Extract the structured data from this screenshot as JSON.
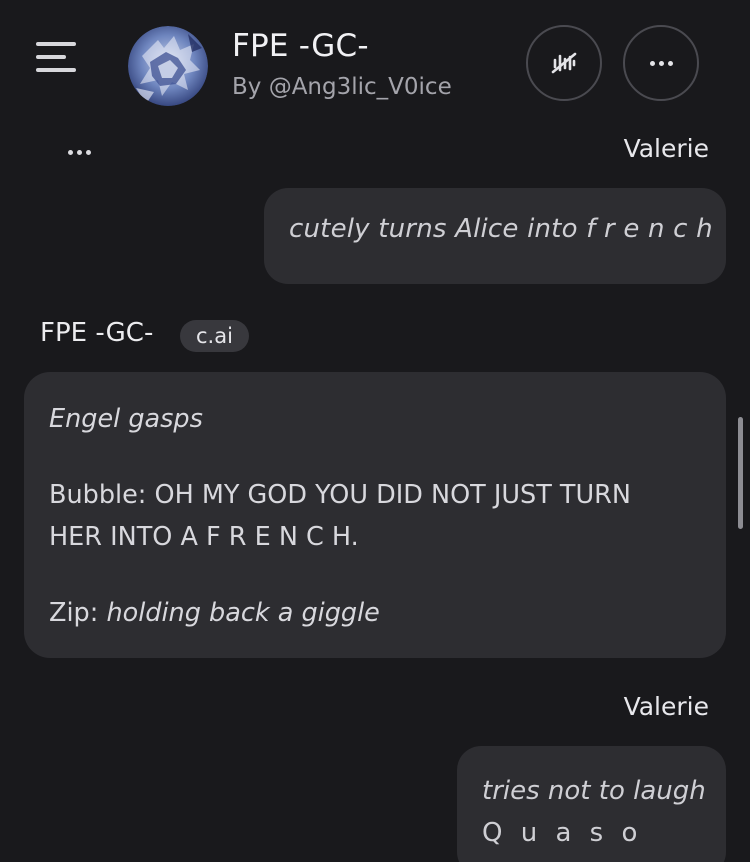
{
  "header": {
    "menu_icon": "hamburger-menu-icon",
    "character_name": "FPE -GC-",
    "creator_byline": "By @Ang3lic_V0ice",
    "voice_icon": "voice-muted-icon",
    "more_icon": "more-horizontal-icon"
  },
  "messages": [
    {
      "sender": "Valerie",
      "role": "user",
      "text": "cutely turns Alice into f r e n c h"
    },
    {
      "sender": "FPE -GC-",
      "badge": "c.ai",
      "role": "character",
      "lines": [
        {
          "text": "Engel gasps"
        },
        {
          "text": "Bubble: OH MY GOD YOU DID NOT JUST TURN"
        },
        {
          "text": "HER INTO A F R E N C H."
        },
        {
          "prefix": "Zip: ",
          "italic": "holding back a giggle"
        }
      ]
    },
    {
      "sender": "Valerie",
      "role": "user",
      "lines": [
        {
          "text": "tries not to laugh"
        },
        {
          "text": "Q u a s o"
        }
      ]
    }
  ],
  "colors": {
    "background": "#19191c",
    "bubble": "#2d2d31",
    "badge": "#38383d",
    "button_border": "#4a4a50"
  }
}
